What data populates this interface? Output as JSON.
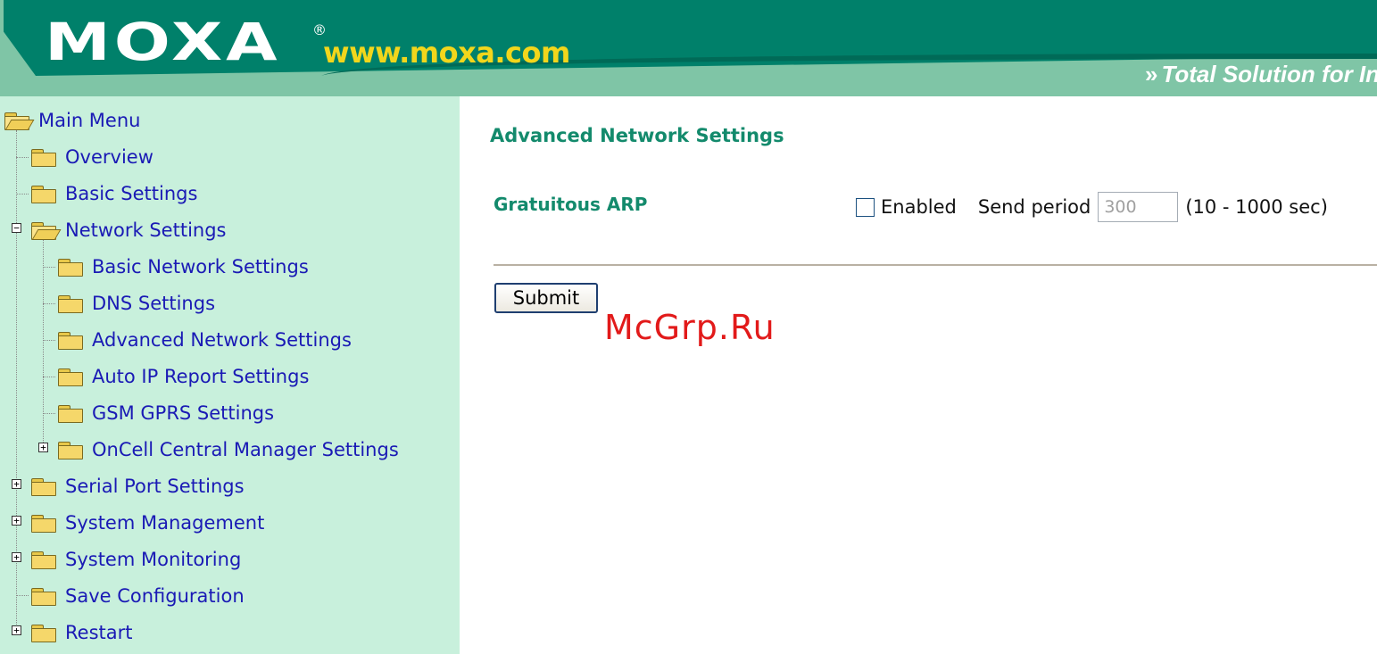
{
  "header": {
    "logo": "MOXA",
    "logo_mark": "®",
    "url": "www.moxa.com",
    "tagline": "Total Solution for In",
    "tagline_glyph": "»"
  },
  "sidebar": {
    "items": [
      {
        "label": "Main Menu",
        "state": "open"
      },
      {
        "label": "Overview"
      },
      {
        "label": "Basic Settings"
      },
      {
        "label": "Network Settings",
        "state": "open"
      },
      {
        "label": "Basic Network Settings"
      },
      {
        "label": "DNS Settings"
      },
      {
        "label": "Advanced Network Settings"
      },
      {
        "label": "Auto IP Report Settings"
      },
      {
        "label": "GSM GPRS Settings"
      },
      {
        "label": "OnCell Central Manager Settings",
        "state": "collapsed"
      },
      {
        "label": "Serial Port Settings",
        "state": "collapsed"
      },
      {
        "label": "System Management",
        "state": "collapsed"
      },
      {
        "label": "System Monitoring",
        "state": "collapsed"
      },
      {
        "label": "Save Configuration"
      },
      {
        "label": "Restart",
        "state": "collapsed"
      }
    ]
  },
  "main": {
    "title": "Advanced Network Settings",
    "gratuitous_arp": {
      "label": "Gratuitous ARP",
      "enabled_label": "Enabled",
      "enabled": false,
      "send_period_label": "Send period",
      "send_period_value": "300",
      "range_text": "(10 - 1000 sec)"
    },
    "submit_label": "Submit"
  },
  "watermark": "McGrp.Ru",
  "colors": {
    "header_green": "#00806a",
    "header_band": "#7fc5a6",
    "url_yellow": "#f2d61c",
    "sidebar_bg": "#c8f0dc",
    "link_blue": "#1a1ab5",
    "title_green": "#138a6c",
    "watermark_red": "#e21a1a"
  }
}
